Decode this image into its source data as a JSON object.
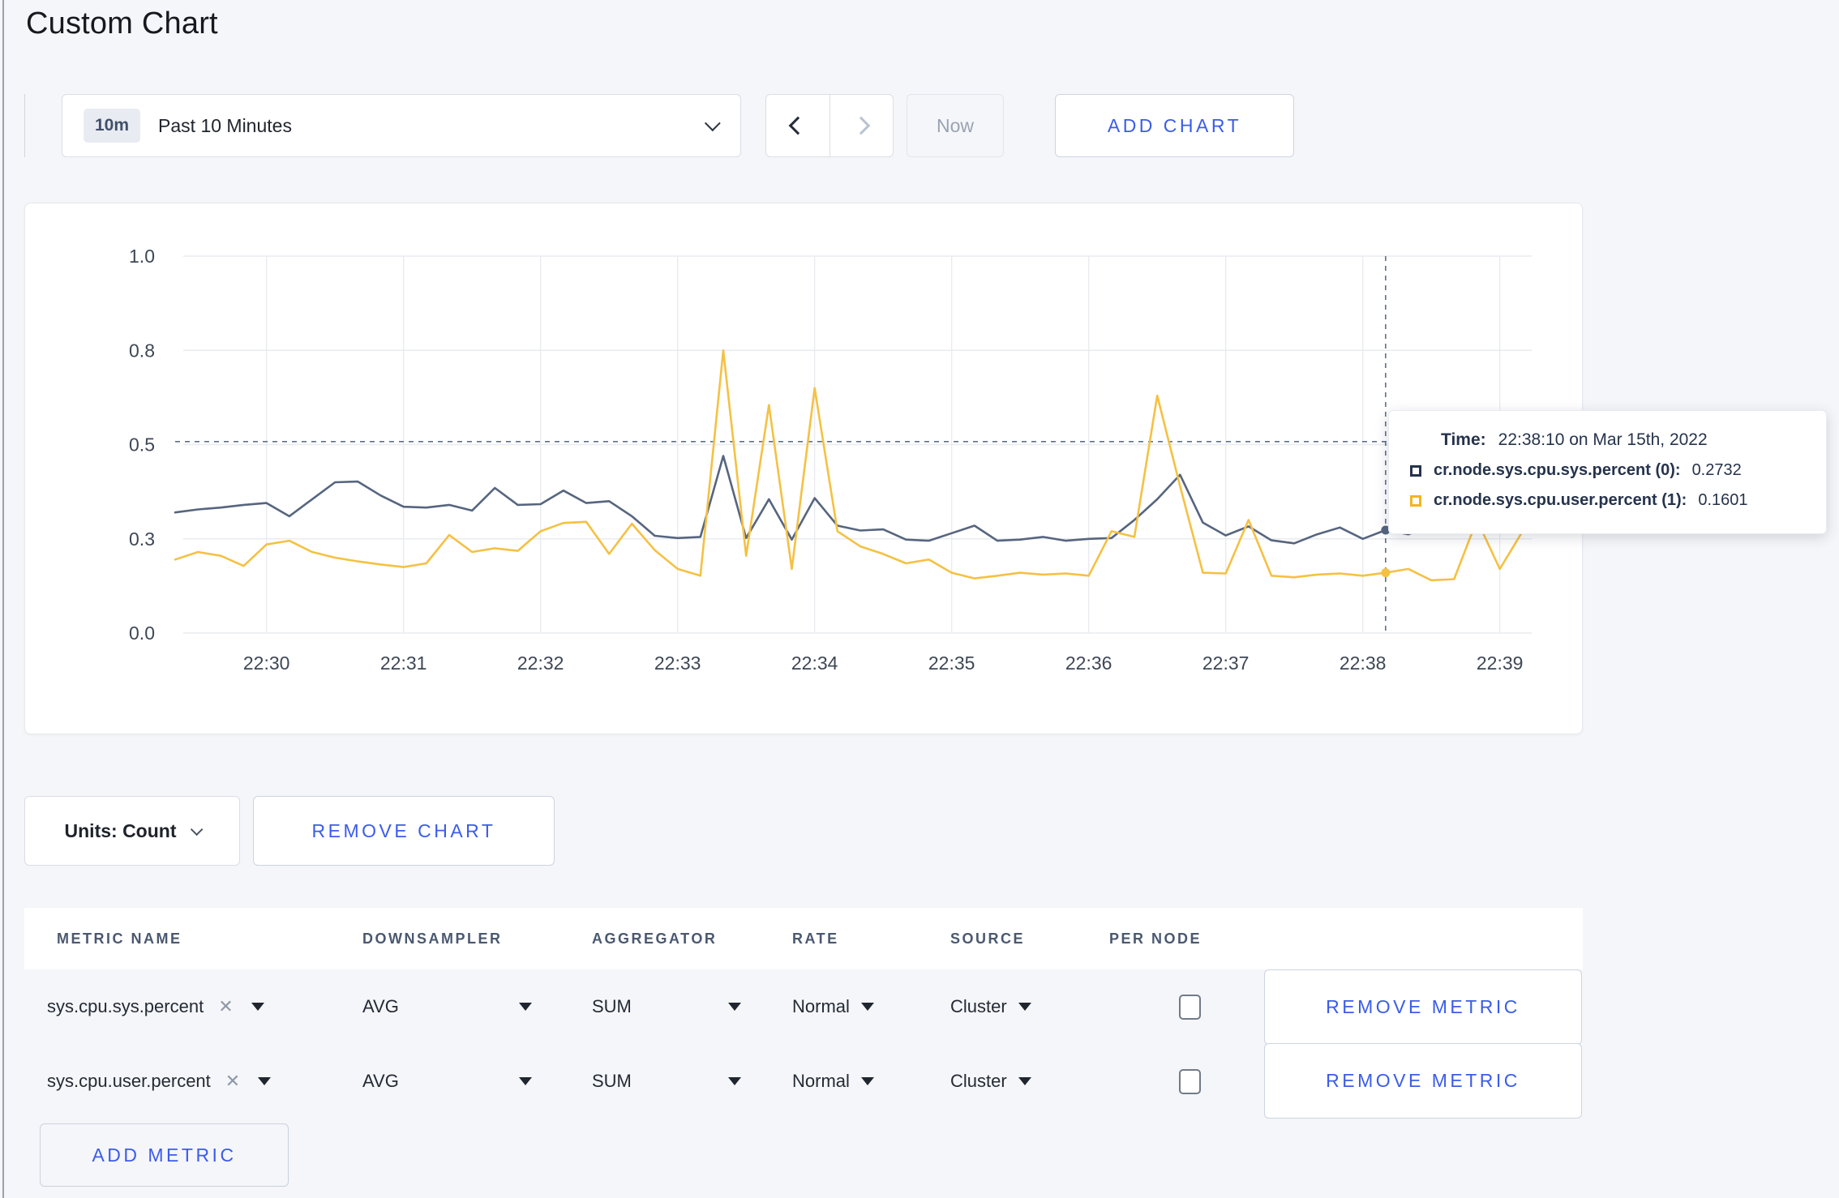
{
  "page_title": "Custom Chart",
  "colors": {
    "accent_blue": "#3b5ce9",
    "series_sys": "#56657f",
    "series_user": "#f5c143",
    "legend_sys_swatch": "#26334d",
    "legend_user_swatch": "#f2b424",
    "page_background": "#f5f6f9"
  },
  "toolbar": {
    "time_badge": "10m",
    "time_range_label": "Past 10 Minutes",
    "now_label": "Now",
    "add_chart_label": "ADD CHART"
  },
  "chart_data": {
    "type": "line",
    "title": "",
    "xlabel": "",
    "ylabel": "",
    "ylim": [
      0,
      1
    ],
    "grid": true,
    "legend_position": "tooltip-only",
    "y_ticks": [
      {
        "label": "0.0",
        "value": 0
      },
      {
        "label": "0.3",
        "value": 0.25
      },
      {
        "label": "0.5",
        "value": 0.5
      },
      {
        "label": "0.8",
        "value": 0.75
      },
      {
        "label": "1.0",
        "value": 1.0
      }
    ],
    "x_ticks": [
      "22:30",
      "22:31",
      "22:32",
      "22:33",
      "22:34",
      "22:35",
      "22:36",
      "22:37",
      "22:38",
      "22:39"
    ],
    "x_start": "22:29:20",
    "x_interval_seconds": 10,
    "series": [
      {
        "name": "cr.node.sys.cpu.sys.percent",
        "color": "#56657f",
        "values": [
          0.32,
          0.328,
          0.333,
          0.34,
          0.345,
          0.31,
          0.355,
          0.4,
          0.402,
          0.365,
          0.335,
          0.333,
          0.34,
          0.325,
          0.385,
          0.34,
          0.342,
          0.378,
          0.345,
          0.35,
          0.31,
          0.258,
          0.252,
          0.255,
          0.47,
          0.252,
          0.355,
          0.248,
          0.358,
          0.285,
          0.272,
          0.275,
          0.248,
          0.245,
          0.265,
          0.285,
          0.245,
          0.248,
          0.255,
          0.245,
          0.25,
          0.252,
          0.3,
          0.355,
          0.42,
          0.293,
          0.259,
          0.283,
          0.246,
          0.238,
          0.262,
          0.28,
          0.25,
          0.2732,
          0.262,
          0.285,
          0.3,
          0.272,
          0.27,
          0.302
        ]
      },
      {
        "name": "cr.node.sys.cpu.user.percent",
        "color": "#f5c143",
        "values": [
          0.195,
          0.215,
          0.205,
          0.178,
          0.235,
          0.245,
          0.215,
          0.2,
          0.19,
          0.182,
          0.175,
          0.185,
          0.26,
          0.215,
          0.225,
          0.218,
          0.27,
          0.292,
          0.295,
          0.21,
          0.29,
          0.22,
          0.17,
          0.152,
          0.75,
          0.205,
          0.605,
          0.17,
          0.65,
          0.27,
          0.23,
          0.21,
          0.185,
          0.195,
          0.16,
          0.145,
          0.152,
          0.16,
          0.155,
          0.158,
          0.152,
          0.27,
          0.255,
          0.63,
          0.39,
          0.16,
          0.158,
          0.3,
          0.152,
          0.148,
          0.155,
          0.158,
          0.152,
          0.1601,
          0.17,
          0.14,
          0.143,
          0.3,
          0.17,
          0.27
        ]
      }
    ],
    "crosshair": {
      "x_index": 53,
      "time": "22:38:10",
      "hover_value": 0.508
    }
  },
  "tooltip": {
    "time_label": "Time:",
    "time_value": "22:38:10 on Mar 15th, 2022",
    "series": [
      {
        "label": "cr.node.sys.cpu.sys.percent (0):",
        "value": "0.2732"
      },
      {
        "label": "cr.node.sys.cpu.user.percent (1):",
        "value": "0.1601"
      }
    ]
  },
  "units_row": {
    "units_label": "Units: Count",
    "remove_chart_label": "REMOVE CHART"
  },
  "metrics_table": {
    "columns": [
      "METRIC NAME",
      "DOWNSAMPLER",
      "AGGREGATOR",
      "RATE",
      "SOURCE",
      "PER NODE"
    ],
    "rows": [
      {
        "name": "sys.cpu.sys.percent",
        "remove_icon": "✕",
        "downsampler": "AVG",
        "aggregator": "SUM",
        "rate": "Normal",
        "source": "Cluster",
        "per_node_checked": false,
        "remove_label": "REMOVE METRIC"
      },
      {
        "name": "sys.cpu.user.percent",
        "remove_icon": "✕",
        "downsampler": "AVG",
        "aggregator": "SUM",
        "rate": "Normal",
        "source": "Cluster",
        "per_node_checked": false,
        "remove_label": "REMOVE METRIC"
      }
    ],
    "add_metric_label": "ADD METRIC"
  }
}
